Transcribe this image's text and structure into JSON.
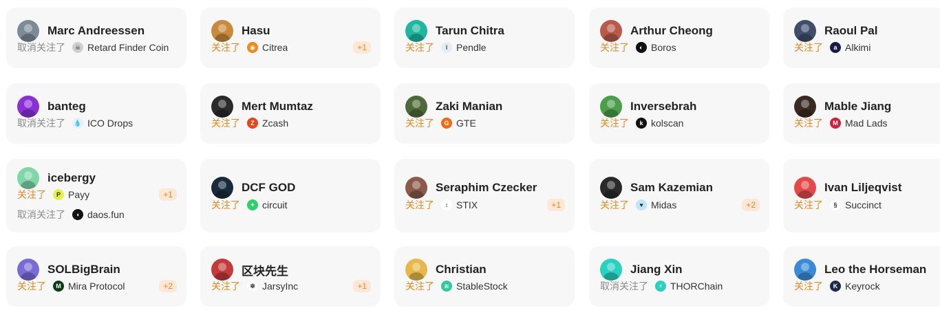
{
  "colors": {
    "accent": "#e8871e",
    "unfollow": "#8a8a8a",
    "card_bg": "#f7f7f7"
  },
  "cards": [
    {
      "name": "Marc Andreessen",
      "avatar_color": "#7d8b99",
      "rows": [
        {
          "status": "取消关注了",
          "type": "unfollow",
          "project": "Retard Finder Coin",
          "icon": "retard-finder-icon",
          "icon_color": "#cfcfcf",
          "icon_glyph": "☠"
        }
      ]
    },
    {
      "name": "Hasu",
      "avatar_color": "#c98a3c",
      "rows": [
        {
          "status": "关注了",
          "type": "follow",
          "project": "Citrea",
          "icon": "citrea-icon",
          "icon_color": "#f08a1c",
          "icon_glyph": "◉",
          "badge": "+1"
        }
      ]
    },
    {
      "name": "Tarun Chitra",
      "avatar_color": "#1fb7a0",
      "rows": [
        {
          "status": "关注了",
          "type": "follow",
          "project": "Pendle",
          "icon": "pendle-icon",
          "icon_color": "#e6ecf5",
          "icon_glyph": "ǀ"
        }
      ]
    },
    {
      "name": "Arthur Cheong",
      "avatar_color": "#b85a4a",
      "rows": [
        {
          "status": "关注了",
          "type": "follow",
          "project": "Boros",
          "icon": "boros-icon",
          "icon_color": "#111111",
          "icon_glyph": "◐"
        }
      ]
    },
    {
      "name": "Raoul Pal",
      "avatar_color": "#3f4e6a",
      "rows": [
        {
          "status": "关注了",
          "type": "follow",
          "project": "Alkimi",
          "icon": "alkimi-icon",
          "icon_color": "#1b1b4a",
          "icon_glyph": "a"
        }
      ]
    },
    {
      "name": "banteg",
      "avatar_color": "#8b2fd6",
      "rows": [
        {
          "status": "取消关注了",
          "type": "unfollow",
          "project": "ICO Drops",
          "icon": "ico-drops-icon",
          "icon_color": "#e6f0fb",
          "icon_glyph": "💧"
        }
      ]
    },
    {
      "name": "Mert Mumtaz",
      "avatar_color": "#2a2a2a",
      "rows": [
        {
          "status": "关注了",
          "type": "follow",
          "project": "Zcash",
          "icon": "zcash-icon",
          "icon_color": "#e2471d",
          "icon_glyph": "Z"
        }
      ]
    },
    {
      "name": "Zaki Manian",
      "avatar_color": "#4f6a3a",
      "rows": [
        {
          "status": "关注了",
          "type": "follow",
          "project": "GTE",
          "icon": "gte-icon",
          "icon_color": "#f06a10",
          "icon_glyph": "G"
        }
      ]
    },
    {
      "name": "Inversebrah",
      "avatar_color": "#4b9e4a",
      "rows": [
        {
          "status": "关注了",
          "type": "follow",
          "project": "kolscan",
          "icon": "kolscan-icon",
          "icon_color": "#111111",
          "icon_glyph": "k"
        }
      ]
    },
    {
      "name": "Mable Jiang",
      "avatar_color": "#3a2a22",
      "rows": [
        {
          "status": "关注了",
          "type": "follow",
          "project": "Mad Lads",
          "icon": "mad-lads-icon",
          "icon_color": "#d0213a",
          "icon_glyph": "M"
        }
      ]
    },
    {
      "name": "icebergy",
      "avatar_color": "#7fd6a8",
      "rows": [
        {
          "status": "关注了",
          "type": "follow",
          "project": "Payy",
          "icon": "payy-icon",
          "icon_color": "#e2f24a",
          "icon_glyph": "P",
          "badge": "+1"
        },
        {
          "status": "取消关注了",
          "type": "unfollow",
          "project": "daos.fun",
          "icon": "daos-fun-icon",
          "icon_color": "#111111",
          "icon_glyph": "◖"
        }
      ]
    },
    {
      "name": "DCF GOD",
      "avatar_color": "#1a2a3a",
      "rows": [
        {
          "status": "关注了",
          "type": "follow",
          "project": "circuit",
          "icon": "circuit-icon",
          "icon_color": "#2fcf6a",
          "icon_glyph": "✦"
        }
      ]
    },
    {
      "name": "Seraphim Czecker",
      "avatar_color": "#8a5a4a",
      "rows": [
        {
          "status": "关注了",
          "type": "follow",
          "project": "STIX",
          "icon": "stix-icon",
          "icon_color": "#ffffff",
          "icon_glyph": "↕",
          "badge": "+1"
        }
      ]
    },
    {
      "name": "Sam Kazemian",
      "avatar_color": "#2a2a2a",
      "rows": [
        {
          "status": "关注了",
          "type": "follow",
          "project": "Midas",
          "icon": "midas-icon",
          "icon_color": "#bfe6f5",
          "icon_glyph": "♥",
          "badge": "+2"
        }
      ]
    },
    {
      "name": "Ivan Liljeqvist",
      "avatar_color": "#e24a4a",
      "rows": [
        {
          "status": "关注了",
          "type": "follow",
          "project": "Succinct",
          "icon": "succinct-icon",
          "icon_color": "#ffffff",
          "icon_glyph": "§"
        }
      ]
    },
    {
      "name": "SOLBigBrain",
      "avatar_color": "#7a6ad6",
      "rows": [
        {
          "status": "关注了",
          "type": "follow",
          "project": "Mira Protocol",
          "icon": "mira-protocol-icon",
          "icon_color": "#0f3a1a",
          "icon_glyph": "M",
          "badge": "+2"
        }
      ]
    },
    {
      "name": "区块先生",
      "avatar_color": "#c23a3a",
      "rows": [
        {
          "status": "关注了",
          "type": "follow",
          "project": "JarsyInc",
          "icon": "jarsyinc-icon",
          "icon_color": "#ffffff",
          "icon_glyph": "✽",
          "badge": "+1"
        }
      ]
    },
    {
      "name": "Christian",
      "avatar_color": "#e6b84a",
      "rows": [
        {
          "status": "关注了",
          "type": "follow",
          "project": "StableStock",
          "icon": "stablestock-icon",
          "icon_color": "#2ec9a0",
          "icon_glyph": "≋"
        }
      ]
    },
    {
      "name": "Jiang Xin",
      "avatar_color": "#2ad0c0",
      "rows": [
        {
          "status": "取消关注了",
          "type": "unfollow",
          "project": "THORChain",
          "icon": "thorchain-icon",
          "icon_color": "#2ad0c0",
          "icon_glyph": "⚡"
        }
      ]
    },
    {
      "name": "Leo the Horseman",
      "avatar_color": "#3a8ad6",
      "rows": [
        {
          "status": "关注了",
          "type": "follow",
          "project": "Keyrock",
          "icon": "keyrock-icon",
          "icon_color": "#1e2a4a",
          "icon_glyph": "K"
        }
      ]
    }
  ]
}
